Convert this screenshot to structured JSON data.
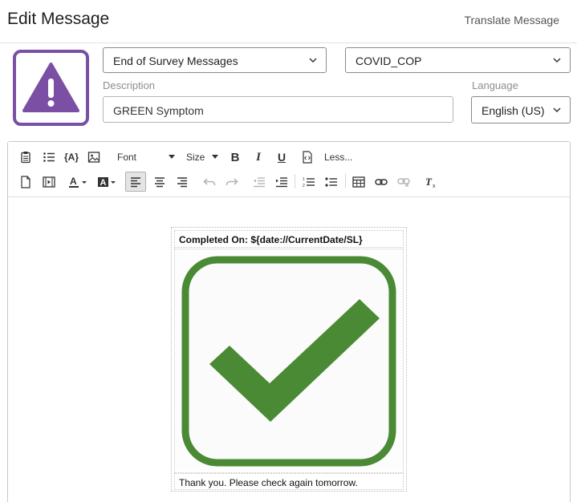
{
  "header": {
    "title": "Edit Message",
    "translate_label": "Translate Message"
  },
  "message_icon": {
    "name": "warning-icon",
    "color": "#7b4fa3"
  },
  "category_select": {
    "value": "End of Survey Messages"
  },
  "library_select": {
    "value": "COVID_COP"
  },
  "description": {
    "label": "Description",
    "value": "GREEN Symptom"
  },
  "language": {
    "label": "Language",
    "value": "English (US)"
  },
  "toolbar": {
    "font_label": "Font",
    "size_label": "Size",
    "bold_label": "B",
    "italic_label": "I",
    "underline_label": "U",
    "less_label": "Less...",
    "piped_text_label": "{A}"
  },
  "message_body": {
    "completed_text": "Completed On: ${date://CurrentDate/SL}",
    "image_icon": "green-checkmark-icon",
    "image_color": "#4b8a35",
    "footer_text": "Thank you. Please check again tomorrow."
  }
}
